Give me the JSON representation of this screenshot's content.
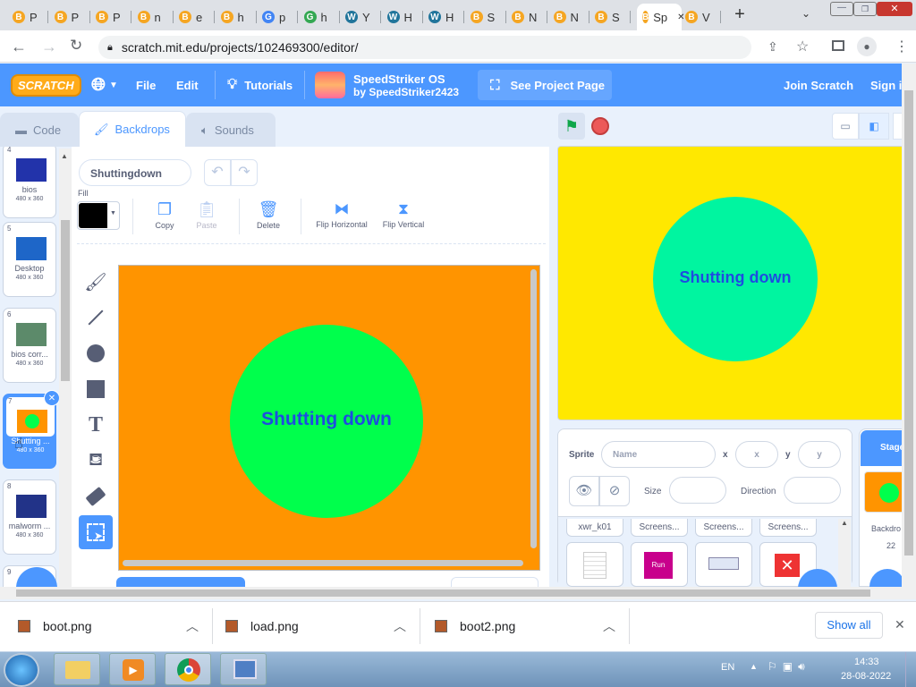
{
  "browser": {
    "tabs": [
      {
        "label": "P",
        "fav": "#f5a623",
        "g": "B"
      },
      {
        "label": "P",
        "fav": "#f5a623",
        "g": "B"
      },
      {
        "label": "P",
        "fav": "#f5a623",
        "g": "B"
      },
      {
        "label": "n",
        "fav": "#f5a623",
        "g": "B"
      },
      {
        "label": "e",
        "fav": "#f5a623",
        "g": "B"
      },
      {
        "label": "h",
        "fav": "#f5a623",
        "g": "B"
      },
      {
        "label": "p",
        "fav": "#4285f4",
        "g": "G"
      },
      {
        "label": "h",
        "fav": "#34a853",
        "g": "G"
      },
      {
        "label": "Y",
        "fav": "#21759b",
        "g": "W"
      },
      {
        "label": "H",
        "fav": "#21759b",
        "g": "W"
      },
      {
        "label": "H",
        "fav": "#21759b",
        "g": "W"
      },
      {
        "label": "S",
        "fav": "#f5a623",
        "g": "B"
      },
      {
        "label": "N",
        "fav": "#f5a623",
        "g": "B"
      },
      {
        "label": "N",
        "fav": "#f5a623",
        "g": "B"
      },
      {
        "label": "S",
        "fav": "#f5a623",
        "g": "B"
      },
      {
        "label": "Sp",
        "fav": "#f5a623",
        "g": "B",
        "active": true
      },
      {
        "label": "V",
        "fav": "#f5a623",
        "g": "B"
      }
    ],
    "url": "scratch.mit.edu/projects/102469300/editor/"
  },
  "menu": {
    "logo": "SCRATCH",
    "file": "File",
    "edit": "Edit",
    "tutorials": "Tutorials",
    "project_title": "SpeedStriker OS",
    "project_by": "by SpeedStriker2423",
    "see_project": "See Project Page",
    "join": "Join Scratch",
    "signin": "Sign in"
  },
  "tabs": {
    "code": "Code",
    "backdrops": "Backdrops",
    "sounds": "Sounds"
  },
  "backdrops": [
    {
      "num": "4",
      "name": "bios",
      "size": "480 x 360",
      "thumb": "#2233aa"
    },
    {
      "num": "5",
      "name": "Desktop",
      "size": "480 x 360",
      "thumb": "#1e66c8"
    },
    {
      "num": "6",
      "name": "bios corr...",
      "size": "480 x 360",
      "thumb": "#5c8a6a"
    },
    {
      "num": "7",
      "name": "Shutting ...",
      "size": "480 x 360",
      "thumb": "#ff9400",
      "selected": true
    },
    {
      "num": "8",
      "name": "malworm ...",
      "size": "480 x 360",
      "thumb": "#223388"
    },
    {
      "num": "9",
      "name": "",
      "size": "",
      "thumb": "#ffffff"
    }
  ],
  "paint": {
    "costume_name": "Shuttingdown",
    "fill_label": "Fill",
    "copy": "Copy",
    "paste": "Paste",
    "delete": "Delete",
    "flip_h": "Flip Horizontal",
    "flip_v": "Flip Vertical",
    "canvas_text": "Shutting down",
    "canvas_bg": "#ff9400",
    "circle": "#00ff4c"
  },
  "stage": {
    "text": "Shutting down",
    "bg": "#ffe800",
    "circle": "#00f5a0"
  },
  "sprite_info": {
    "sprite_label": "Sprite",
    "name_placeholder": "Name",
    "x_label": "x",
    "x_placeholder": "x",
    "y_label": "y",
    "y_placeholder": "y",
    "size_label": "Size",
    "direction_label": "Direction",
    "sprites": [
      "xwr_k01",
      "Screens...",
      "Screens...",
      "Screens..."
    ]
  },
  "stage_col": {
    "title": "Stage",
    "backdrops_label": "Backdro",
    "backdrops_count": "22"
  },
  "downloads": {
    "files": [
      "boot.png",
      "load.png",
      "boot2.png"
    ],
    "show_all": "Show all"
  },
  "taskbar": {
    "lang": "EN",
    "time": "14:33",
    "date": "28-08-2022"
  }
}
